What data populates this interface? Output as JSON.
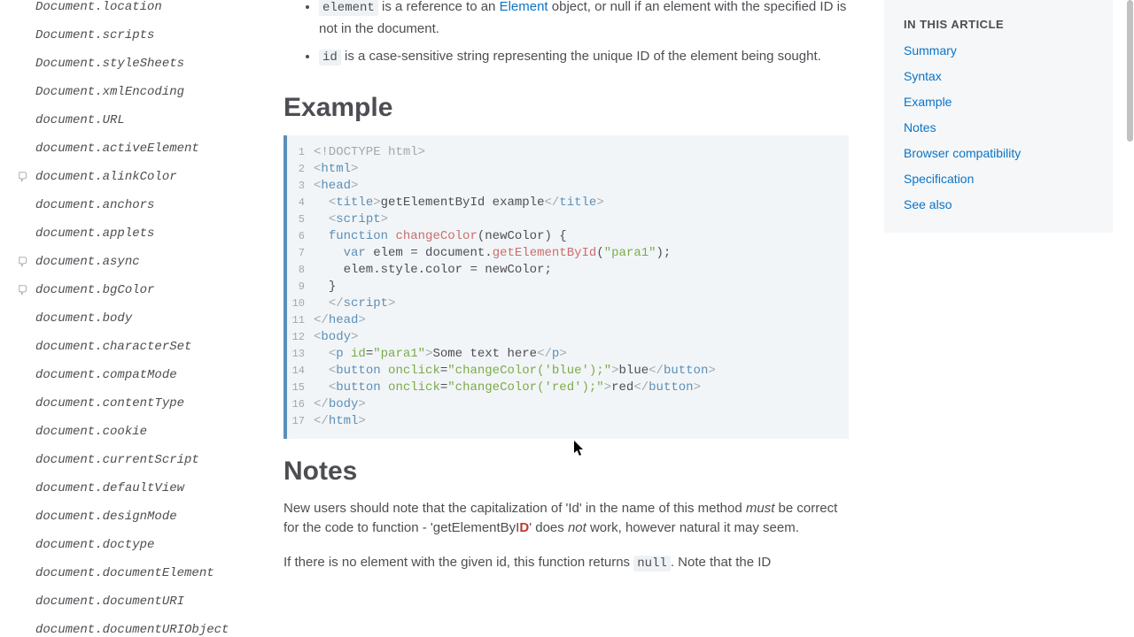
{
  "sidebar": {
    "items": [
      {
        "label": "Document.location",
        "deprecated": false
      },
      {
        "label": "Document.scripts",
        "deprecated": false
      },
      {
        "label": "Document.styleSheets",
        "deprecated": false
      },
      {
        "label": "Document.xmlEncoding",
        "deprecated": false
      },
      {
        "label": "document.URL",
        "deprecated": false
      },
      {
        "label": "document.activeElement",
        "deprecated": false
      },
      {
        "label": "document.alinkColor",
        "deprecated": true
      },
      {
        "label": "document.anchors",
        "deprecated": false
      },
      {
        "label": "document.applets",
        "deprecated": false
      },
      {
        "label": "document.async",
        "deprecated": true
      },
      {
        "label": "document.bgColor",
        "deprecated": true
      },
      {
        "label": "document.body",
        "deprecated": false
      },
      {
        "label": "document.characterSet",
        "deprecated": false
      },
      {
        "label": "document.compatMode",
        "deprecated": false
      },
      {
        "label": "document.contentType",
        "deprecated": false
      },
      {
        "label": "document.cookie",
        "deprecated": false
      },
      {
        "label": "document.currentScript",
        "deprecated": false
      },
      {
        "label": "document.defaultView",
        "deprecated": false
      },
      {
        "label": "document.designMode",
        "deprecated": false
      },
      {
        "label": "document.doctype",
        "deprecated": false
      },
      {
        "label": "document.documentElement",
        "deprecated": false
      },
      {
        "label": "document.documentURI",
        "deprecated": false
      },
      {
        "label": "document.documentURIObject",
        "deprecated": false
      }
    ]
  },
  "defs": {
    "element_code": "element",
    "element_txt1": " is a reference to an ",
    "element_link": "Element",
    "element_txt2": " object, or null if an element with the specified ID is not in the document.",
    "id_code": "id",
    "id_txt": " is a case-sensitive string representing the unique ID of the element being sought."
  },
  "headings": {
    "example": "Example",
    "notes": "Notes"
  },
  "code_lines": [
    {
      "n": 1,
      "segs": [
        [
          "doctype",
          "<!DOCTYPE html>"
        ]
      ]
    },
    {
      "n": 2,
      "segs": [
        [
          "angle",
          "<"
        ],
        [
          "tag",
          "html"
        ],
        [
          "angle",
          ">"
        ]
      ]
    },
    {
      "n": 3,
      "segs": [
        [
          "angle",
          "<"
        ],
        [
          "tag",
          "head"
        ],
        [
          "angle",
          ">"
        ]
      ]
    },
    {
      "n": 4,
      "segs": [
        [
          "txt",
          "  "
        ],
        [
          "angle",
          "<"
        ],
        [
          "tag",
          "title"
        ],
        [
          "angle",
          ">"
        ],
        [
          "txt",
          "getElementById example"
        ],
        [
          "angle",
          "</"
        ],
        [
          "tag",
          "title"
        ],
        [
          "angle",
          ">"
        ]
      ]
    },
    {
      "n": 5,
      "segs": [
        [
          "txt",
          "  "
        ],
        [
          "angle",
          "<"
        ],
        [
          "tag",
          "script"
        ],
        [
          "angle",
          ">"
        ]
      ]
    },
    {
      "n": 6,
      "segs": [
        [
          "txt",
          "  "
        ],
        [
          "kw",
          "function"
        ],
        [
          "txt",
          " "
        ],
        [
          "func",
          "changeColor"
        ],
        [
          "punc",
          "("
        ],
        [
          "txt",
          "newColor"
        ],
        [
          "punc",
          ")"
        ],
        [
          "txt",
          " "
        ],
        [
          "punc",
          "{"
        ]
      ]
    },
    {
      "n": 7,
      "segs": [
        [
          "txt",
          "    "
        ],
        [
          "kw",
          "var"
        ],
        [
          "txt",
          " elem "
        ],
        [
          "punc",
          "="
        ],
        [
          "txt",
          " document"
        ],
        [
          "punc",
          "."
        ],
        [
          "func",
          "getElementById"
        ],
        [
          "punc",
          "("
        ],
        [
          "str",
          "\"para1\""
        ],
        [
          "punc",
          ");"
        ]
      ]
    },
    {
      "n": 8,
      "segs": [
        [
          "txt",
          "    elem"
        ],
        [
          "punc",
          "."
        ],
        [
          "txt",
          "style"
        ],
        [
          "punc",
          "."
        ],
        [
          "txt",
          "color "
        ],
        [
          "punc",
          "="
        ],
        [
          "txt",
          " newColor"
        ],
        [
          "punc",
          ";"
        ]
      ]
    },
    {
      "n": 9,
      "segs": [
        [
          "txt",
          "  "
        ],
        [
          "punc",
          "}"
        ]
      ]
    },
    {
      "n": 10,
      "segs": [
        [
          "txt",
          "  "
        ],
        [
          "angle",
          "</"
        ],
        [
          "tag",
          "script"
        ],
        [
          "angle",
          ">"
        ]
      ]
    },
    {
      "n": 11,
      "segs": [
        [
          "angle",
          "</"
        ],
        [
          "tag",
          "head"
        ],
        [
          "angle",
          ">"
        ]
      ]
    },
    {
      "n": 12,
      "segs": [
        [
          "angle",
          "<"
        ],
        [
          "tag",
          "body"
        ],
        [
          "angle",
          ">"
        ]
      ]
    },
    {
      "n": 13,
      "segs": [
        [
          "txt",
          "  "
        ],
        [
          "angle",
          "<"
        ],
        [
          "tag",
          "p"
        ],
        [
          "txt",
          " "
        ],
        [
          "attr",
          "id"
        ],
        [
          "punc",
          "="
        ],
        [
          "str",
          "\"para1\""
        ],
        [
          "angle",
          ">"
        ],
        [
          "txt",
          "Some text here"
        ],
        [
          "angle",
          "</"
        ],
        [
          "tag",
          "p"
        ],
        [
          "angle",
          ">"
        ]
      ]
    },
    {
      "n": 14,
      "segs": [
        [
          "txt",
          "  "
        ],
        [
          "angle",
          "<"
        ],
        [
          "tag",
          "button"
        ],
        [
          "txt",
          " "
        ],
        [
          "attr",
          "onclick"
        ],
        [
          "punc",
          "="
        ],
        [
          "str",
          "\"changeColor('blue');\""
        ],
        [
          "angle",
          ">"
        ],
        [
          "txt",
          "blue"
        ],
        [
          "angle",
          "</"
        ],
        [
          "tag",
          "button"
        ],
        [
          "angle",
          ">"
        ]
      ]
    },
    {
      "n": 15,
      "segs": [
        [
          "txt",
          "  "
        ],
        [
          "angle",
          "<"
        ],
        [
          "tag",
          "button"
        ],
        [
          "txt",
          " "
        ],
        [
          "attr",
          "onclick"
        ],
        [
          "punc",
          "="
        ],
        [
          "str",
          "\"changeColor('red');\""
        ],
        [
          "angle",
          ">"
        ],
        [
          "txt",
          "red"
        ],
        [
          "angle",
          "</"
        ],
        [
          "tag",
          "button"
        ],
        [
          "angle",
          ">"
        ]
      ]
    },
    {
      "n": 16,
      "segs": [
        [
          "angle",
          "</"
        ],
        [
          "tag",
          "body"
        ],
        [
          "angle",
          ">"
        ]
      ]
    },
    {
      "n": 17,
      "segs": [
        [
          "angle",
          "</"
        ],
        [
          "tag",
          "html"
        ],
        [
          "angle",
          ">"
        ]
      ]
    }
  ],
  "notes": {
    "p1_a": "New users should note that the capitalization of 'Id' in the name of this method ",
    "p1_must": "must",
    "p1_b": " be correct for the code to function - 'getElementByI",
    "p1_D": "D",
    "p1_c": "' does ",
    "p1_not": "not",
    "p1_d": " work, however natural it may seem.",
    "p2_a": "If there is no element with the given id, this function returns ",
    "p2_null": "null",
    "p2_b": ". Note that the ID"
  },
  "toc": {
    "heading": "IN THIS ARTICLE",
    "items": [
      "Summary",
      "Syntax",
      "Example",
      "Notes",
      "Browser compatibility",
      "Specification",
      "See also"
    ]
  }
}
